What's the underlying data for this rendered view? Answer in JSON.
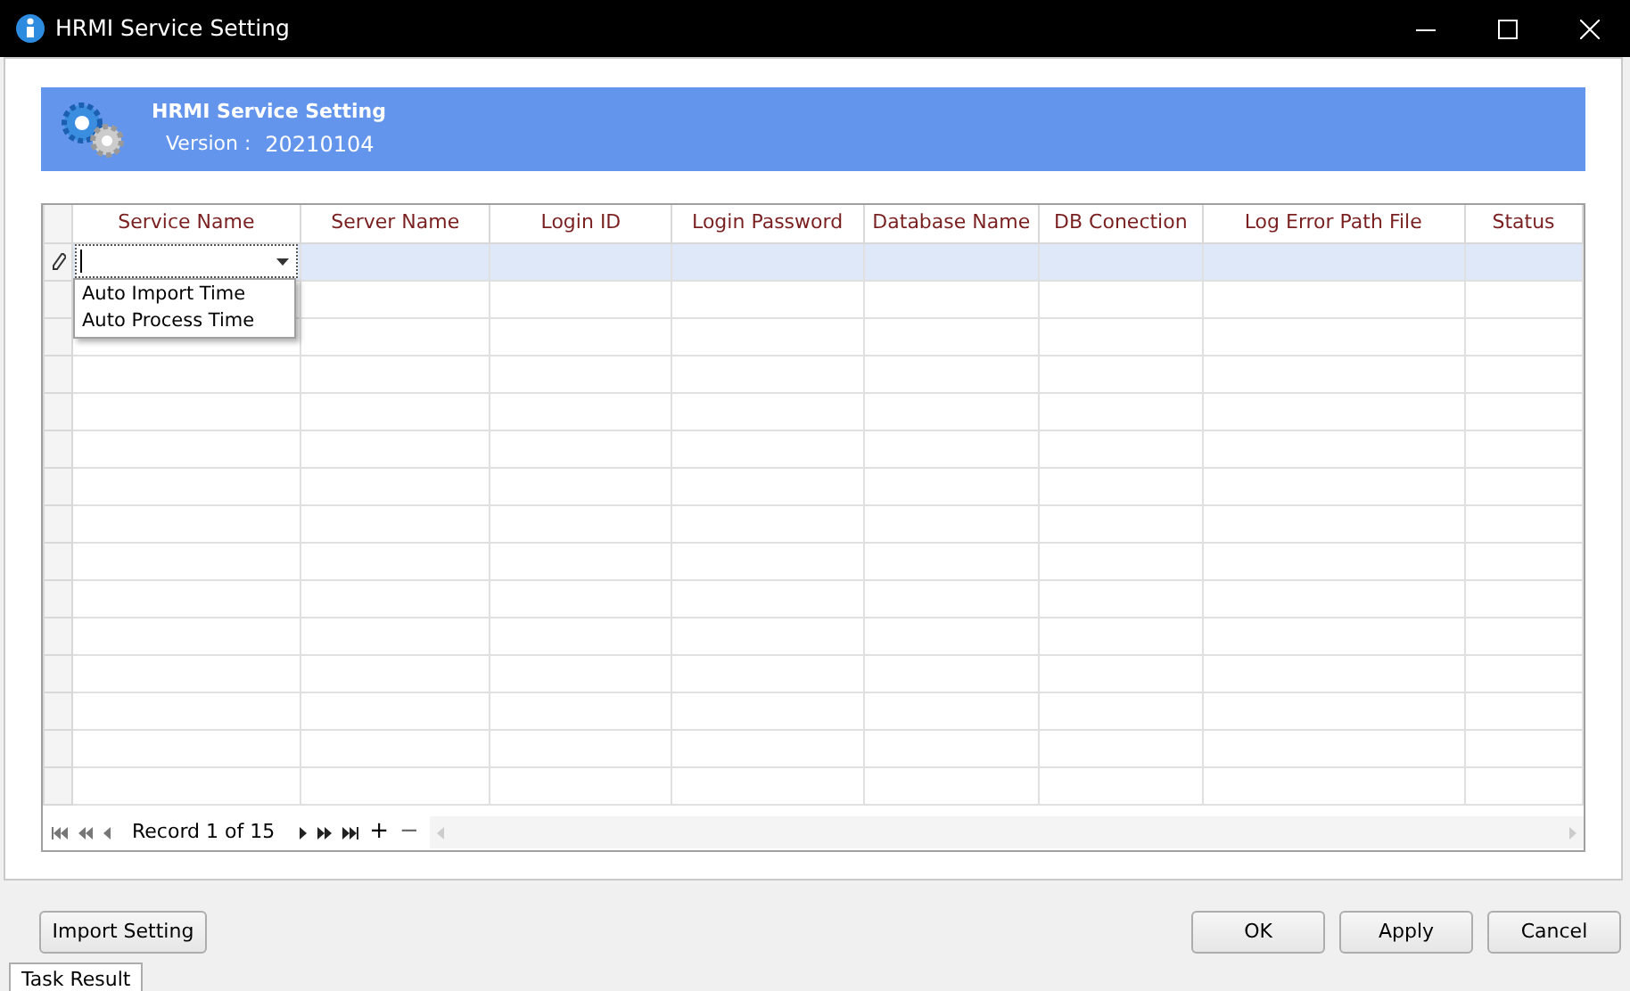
{
  "window": {
    "title": "HRMI Service Setting"
  },
  "header": {
    "title": "HRMI Service Setting",
    "version_label": "Version :",
    "version": "20210104"
  },
  "grid": {
    "columns": [
      "Service Name",
      "Server Name",
      "Login ID",
      "Login Password",
      "Database Name",
      "DB Conection",
      "Log Error Path File",
      "Status"
    ],
    "rows": [
      {
        "selected": true
      },
      {
        "selected": false
      },
      {
        "selected": false
      },
      {
        "selected": false
      },
      {
        "selected": false
      },
      {
        "selected": false
      },
      {
        "selected": false
      },
      {
        "selected": false
      },
      {
        "selected": false
      },
      {
        "selected": false
      },
      {
        "selected": false
      },
      {
        "selected": false
      },
      {
        "selected": false
      },
      {
        "selected": false
      },
      {
        "selected": false
      }
    ],
    "editor": {
      "options": [
        "Auto Import Time",
        "Auto Process Time"
      ]
    },
    "navigator": {
      "record": "Record 1 of 15",
      "append": "+",
      "remove": "−"
    }
  },
  "buttons": {
    "import": "Import Setting",
    "ok": "OK",
    "apply": "Apply",
    "cancel": "Cancel"
  },
  "tabs": [
    {
      "label": "Task Result",
      "selected": true
    }
  ]
}
